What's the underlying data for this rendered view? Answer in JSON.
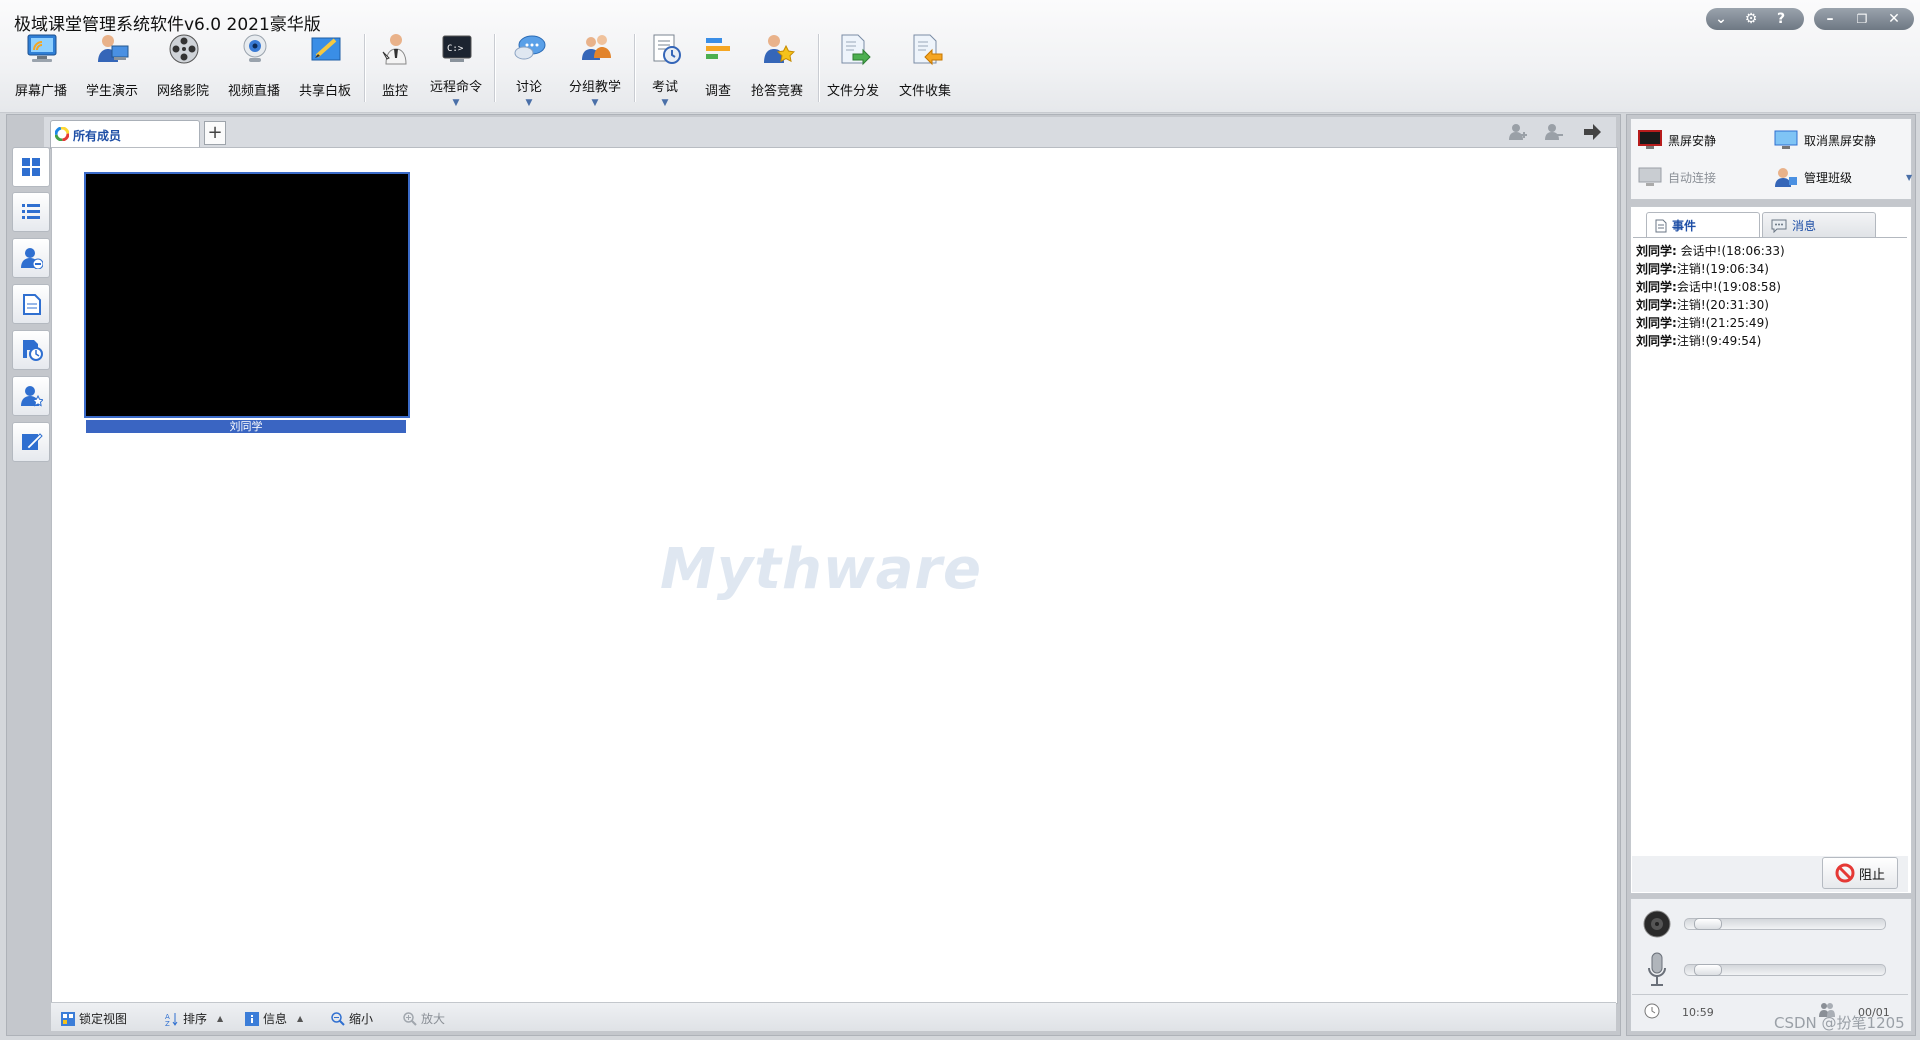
{
  "app": {
    "title": "极域课堂管理系统软件v6.0 2021豪华版"
  },
  "toolbar": {
    "items": [
      {
        "label": "屏幕广播",
        "icon": "screen-broadcast-icon"
      },
      {
        "label": "学生演示",
        "icon": "student-demo-icon"
      },
      {
        "label": "网络影院",
        "icon": "film-reel-icon"
      },
      {
        "label": "视频直播",
        "icon": "webcam-icon"
      },
      {
        "label": "共享白板",
        "icon": "whiteboard-icon"
      },
      {
        "label": "监控",
        "icon": "monitor-person-icon"
      },
      {
        "label": "远程命令",
        "icon": "terminal-icon"
      },
      {
        "label": "讨论",
        "icon": "chat-bubble-icon"
      },
      {
        "label": "分组教学",
        "icon": "group-users-icon"
      },
      {
        "label": "考试",
        "icon": "exam-icon"
      },
      {
        "label": "调查",
        "icon": "survey-icon"
      },
      {
        "label": "抢答竞赛",
        "icon": "quiz-star-icon"
      },
      {
        "label": "文件分发",
        "icon": "file-send-icon"
      },
      {
        "label": "文件收集",
        "icon": "file-collect-icon"
      }
    ],
    "dropdown_glyph": "▼"
  },
  "window": {
    "collapse": "⌄",
    "settings": "⚙",
    "help": "?",
    "minimize": "–",
    "restore": "❐",
    "close": "✕"
  },
  "tabs": {
    "all_members": "所有成员",
    "add": "+"
  },
  "students": [
    {
      "name": "刘同学"
    }
  ],
  "watermark": "Mythware",
  "bottom_bar": {
    "lock_view": "锁定视图",
    "sort": "排序",
    "info": "信息",
    "zoom_out": "缩小",
    "zoom_in": "放大"
  },
  "right_panel": {
    "black_screen": "黑屏安静",
    "cancel_black_screen": "取消黑屏安静",
    "auto_connect": "自动连接",
    "manage_class": "管理班级",
    "tab_events": "事件",
    "tab_messages": "消息",
    "events": [
      {
        "who": "刘同学:",
        "text": "会话中!(18:06:33)"
      },
      {
        "who": "刘同学:",
        "text": "注销!(19:06:34)"
      },
      {
        "who": "刘同学:",
        "text": "会话中!(19:08:58)"
      },
      {
        "who": "刘同学:",
        "text": "注销!(20:31:30)"
      },
      {
        "who": "刘同学:",
        "text": "注销!(21:25:49)"
      },
      {
        "who": "刘同学:",
        "text": "注销!(9:49:54)"
      }
    ],
    "block_button": "阻止",
    "speaker_volume": 0.05,
    "mic_volume": 0.05,
    "clock": "10:59",
    "count": "00/01"
  },
  "overlay_watermark": "CSDN @扮笔1205"
}
